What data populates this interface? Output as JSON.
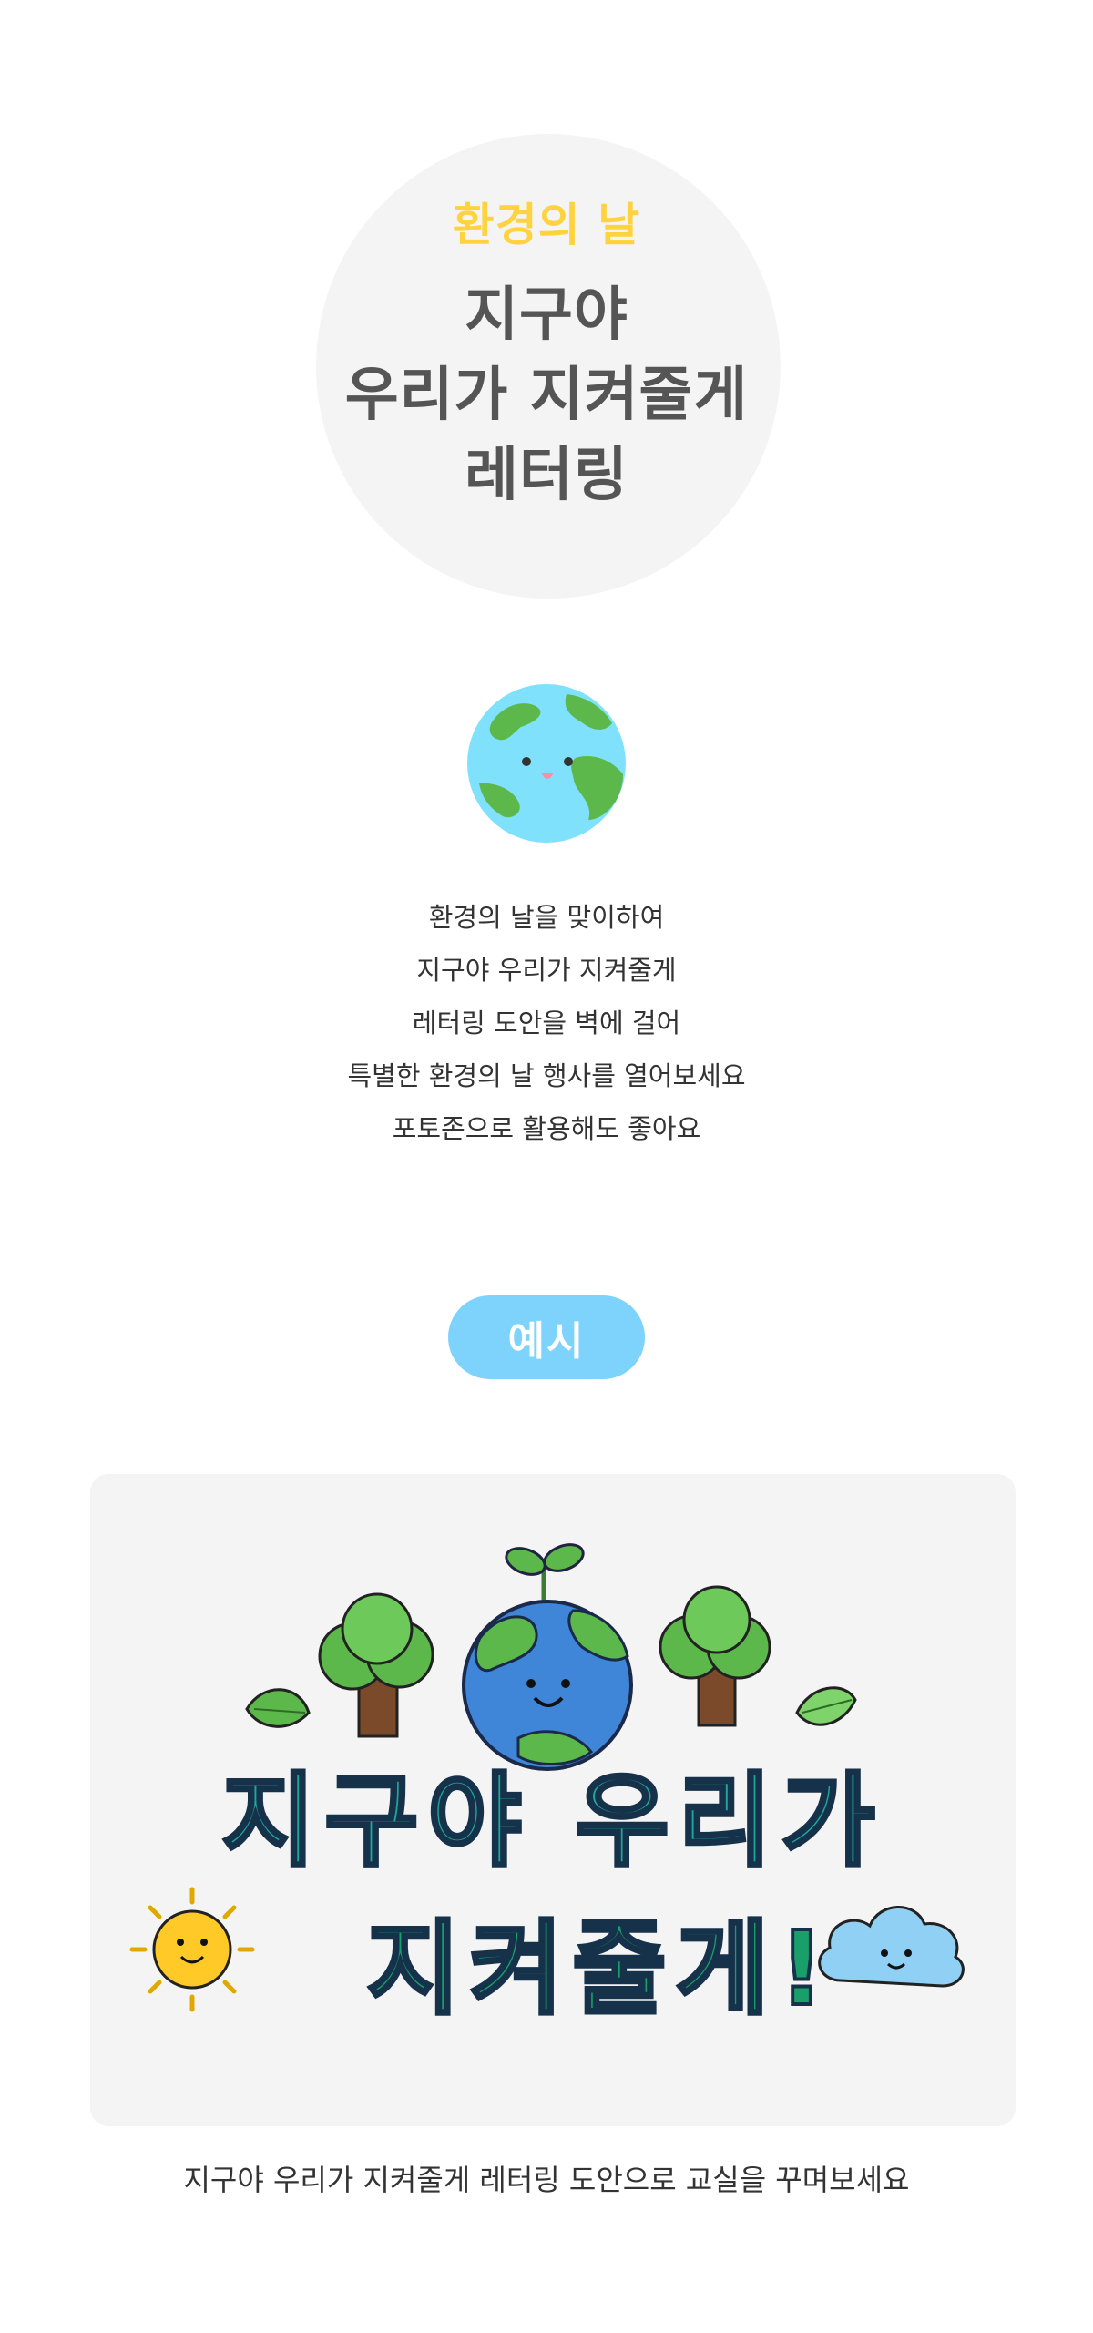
{
  "hero": {
    "subtitle": "환경의 날",
    "title_lines": [
      "지구야",
      "우리가 지켜줄게",
      "레터링"
    ]
  },
  "icons": {
    "earth": "smiling-earth-icon"
  },
  "description": {
    "lines": [
      "환경의 날을 맞이하여",
      "지구야 우리가 지켜줄게",
      "레터링 도안을 벽에 걸어",
      "특별한 환경의 날 행사를 열어보세요",
      "포토존으로 활용해도 좋아요"
    ]
  },
  "example": {
    "label": "예시",
    "lettering_line1": "지구야 우리가",
    "lettering_line2": "지켜줄게!"
  },
  "caption": "지구야 우리가 지켜줄게 레터링 도안으로 교실을 꾸며보세요",
  "colors": {
    "accent_yellow": "#ffd23f",
    "accent_blue": "#7dd3fb",
    "title_gray": "#555555",
    "card_bg": "#f4f4f4",
    "lettering_teal": "#1ea79a",
    "lettering_blue": "#2f79c8"
  }
}
